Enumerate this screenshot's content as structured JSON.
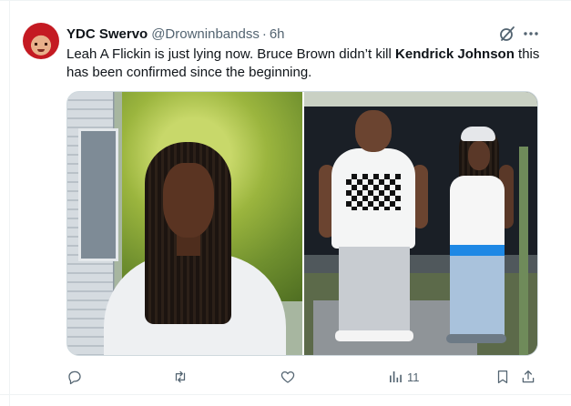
{
  "tweet": {
    "display_name": "YDC Swervo",
    "handle": "@Drowninbandss",
    "separator": "·",
    "time": "6h",
    "text_part1": "Leah A Flickin is just lying now. Bruce Brown didn’t kill ",
    "text_bold": "Kendrick Johnson",
    "text_part2": " this has been confirmed since the beginning.",
    "views_count": "11"
  },
  "icons": {
    "reply": "reply-icon",
    "retweet": "retweet-icon",
    "like": "like-icon",
    "views": "views-icon",
    "bookmark": "bookmark-icon",
    "share": "share-icon",
    "grok": "grok-icon",
    "more": "more-icon"
  },
  "colors": {
    "text_primary": "#0f1419",
    "text_secondary": "#536471",
    "border": "#cfd9de"
  }
}
